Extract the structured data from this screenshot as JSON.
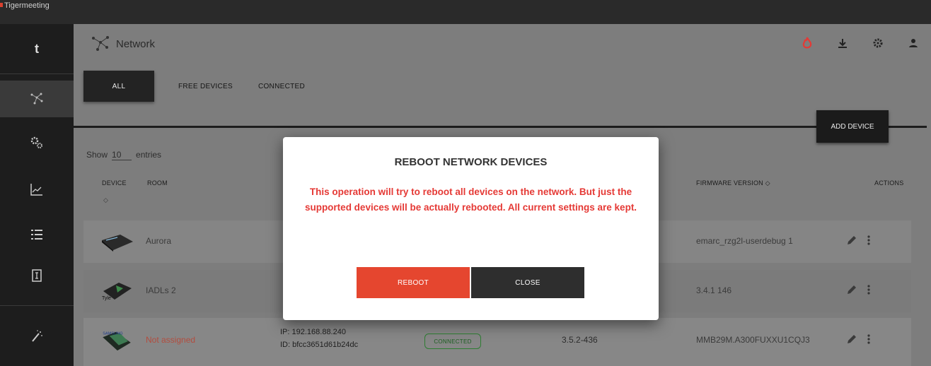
{
  "app": {
    "title": "Tigermeeting"
  },
  "header": {
    "title": "Network"
  },
  "tabs": [
    {
      "label": "ALL",
      "active": true
    },
    {
      "label": "FREE DEVICES",
      "active": false
    },
    {
      "label": "CONNECTED",
      "active": false
    }
  ],
  "sidebar": {
    "logo": "t",
    "items": [
      {
        "name": "network",
        "icon": "network-icon",
        "active": true
      },
      {
        "name": "settings",
        "icon": "gears-icon"
      },
      {
        "name": "stats",
        "icon": "chart-icon"
      },
      {
        "name": "list",
        "icon": "list-icon"
      },
      {
        "name": "document",
        "icon": "document-icon"
      },
      {
        "name": "magic",
        "icon": "wand-icon"
      }
    ]
  },
  "toolbar": {
    "add_device_label": "ADD DEVICE"
  },
  "table": {
    "show_label": "Show",
    "show_value": "10",
    "entries_label": "entries",
    "columns": {
      "device": "DEVICE",
      "device_sort": "◇",
      "room": "ROOM",
      "firmware": "FIRMWARE VERSION ◇",
      "actions": "ACTIONS"
    },
    "rows": [
      {
        "room": "Aurora",
        "ip": "",
        "id": "",
        "status": "",
        "version": "",
        "firmware": "emarc_rzg2l-userdebug 1"
      },
      {
        "room": "IADLs 2",
        "ip": "",
        "id": "",
        "status": "",
        "version": "",
        "firmware": "3.4.1 146"
      },
      {
        "room": "Not assigned",
        "ip": "IP: 192.168.88.240",
        "id": "ID: bfcc3651d61b24dc",
        "status": "CONNECTED",
        "version": "3.5.2-436",
        "firmware": "MMB29M.A300FUXXU1CQJ3"
      }
    ]
  },
  "modal": {
    "title": "REBOOT NETWORK DEVICES",
    "message": "This operation will try to reboot all devices on the network. But just the supported devices will be actually rebooted. All current settings are kept.",
    "reboot_label": "REBOOT",
    "close_label": "CLOSE"
  },
  "colors": {
    "danger": "#e53935",
    "primary_red": "#e5462f",
    "dark": "#2e2e2e",
    "connected_green": "#2e7d32"
  }
}
